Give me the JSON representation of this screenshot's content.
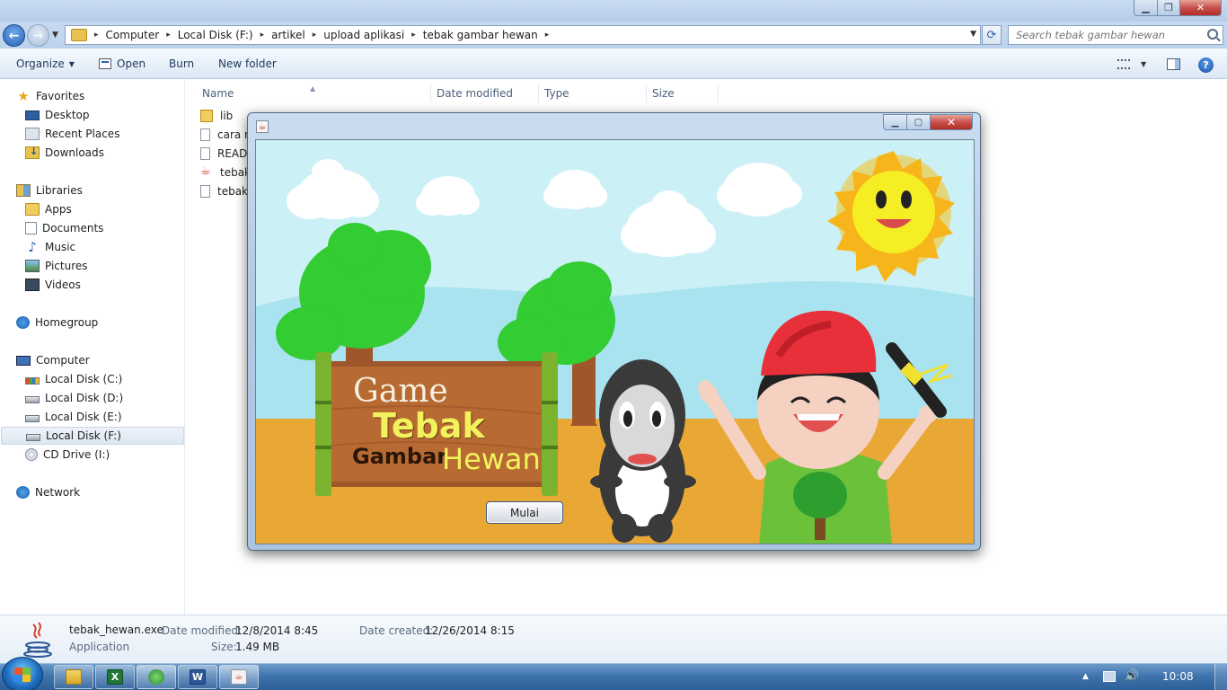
{
  "explorer": {
    "breadcrumb": [
      "Computer",
      "Local Disk (F:)",
      "artikel",
      "upload aplikasi",
      "tebak gambar hewan"
    ],
    "search_placeholder": "Search tebak gambar hewan",
    "commands": {
      "organize": "Organize",
      "open": "Open",
      "burn": "Burn",
      "new_folder": "New folder"
    },
    "nav": {
      "favorites": "Favorites",
      "favorites_items": [
        "Desktop",
        "Recent Places",
        "Downloads"
      ],
      "libraries": "Libraries",
      "libraries_items": [
        "Apps",
        "Documents",
        "Music",
        "Pictures",
        "Videos"
      ],
      "homegroup": "Homegroup",
      "computer": "Computer",
      "computer_items": [
        "Local Disk (C:)",
        "Local Disk (D:)",
        "Local Disk (E:)",
        "Local Disk (F:)",
        "CD Drive (I:)"
      ],
      "network": "Network",
      "selected": "Local Disk (F:)"
    },
    "columns": [
      "Name",
      "Date modified",
      "Type",
      "Size"
    ],
    "files": [
      {
        "name": "lib",
        "icon": "folder-icon"
      },
      {
        "name": "cara r",
        "icon": "text-file-icon"
      },
      {
        "name": "READ",
        "icon": "text-file-icon"
      },
      {
        "name": "tebak",
        "icon": "java-exe-icon"
      },
      {
        "name": "tebak",
        "icon": "jar-file-icon"
      }
    ],
    "details": {
      "file_name": "tebak_hewan.exe",
      "file_type": "Application",
      "date_modified_label": "Date modified:",
      "date_modified": "12/8/2014 8:45",
      "size_label": "Size:",
      "size": "1.49 MB",
      "date_created_label": "Date created:",
      "date_created": "12/26/2014 8:15"
    }
  },
  "game": {
    "title_line1": "Game",
    "title_line2": "Tebak",
    "title_line3a": "Gambar",
    "title_line3b": "Hewan",
    "start_button": "Mulai"
  },
  "taskbar": {
    "apps": [
      "explorer-icon",
      "excel-icon",
      "network-app-icon",
      "word-icon",
      "java-app-icon"
    ],
    "clock": "10:08"
  },
  "colors": {
    "sky": "#cbf1f6",
    "ground": "#e9a835",
    "tree": "#33cc33",
    "sign_wood": "#a0562b",
    "title_yellow": "#f2f25c",
    "hat_red": "#e8303a",
    "shirt_green": "#6cc13b"
  }
}
